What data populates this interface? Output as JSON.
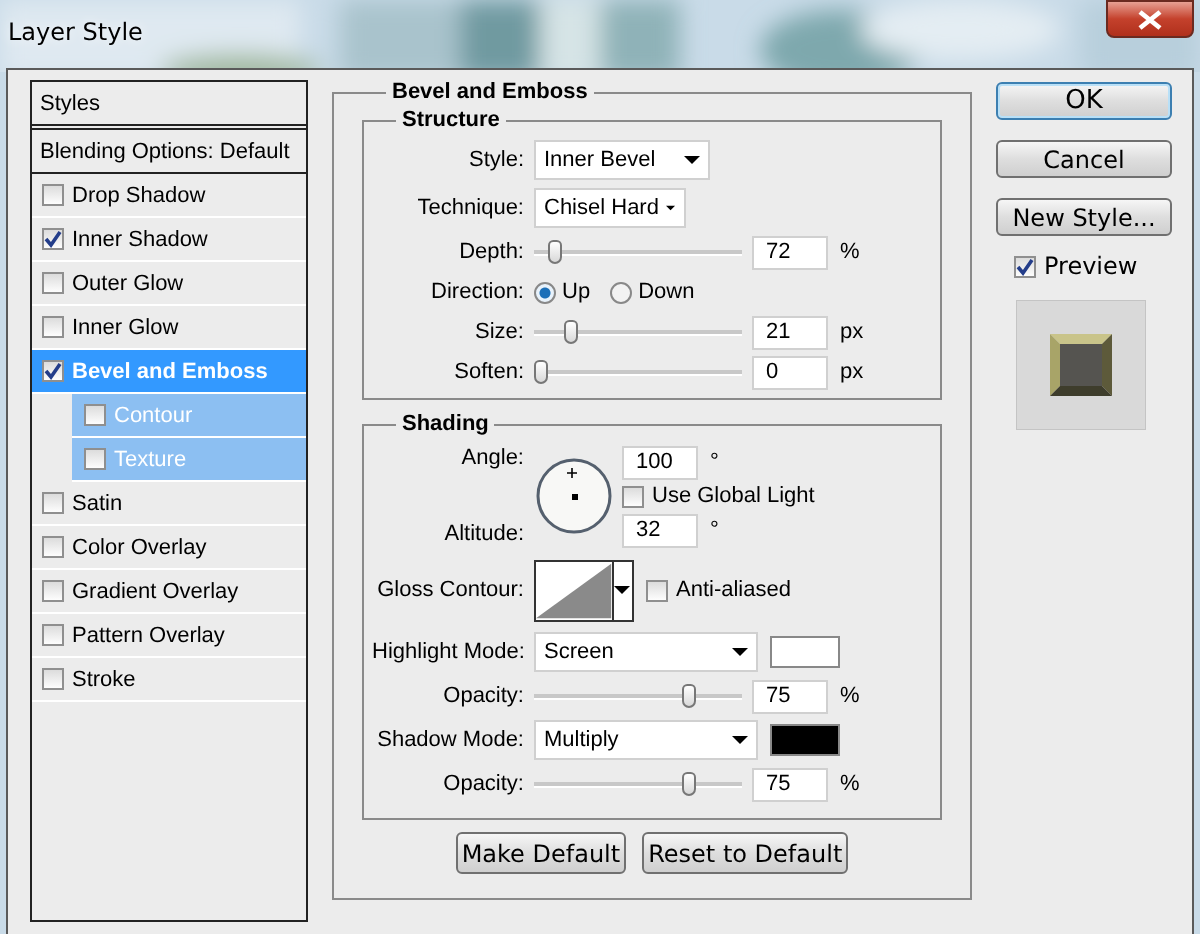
{
  "window": {
    "title": "Layer Style"
  },
  "style_list": [
    {
      "label": "Styles",
      "kind": "header",
      "selected": false
    },
    {
      "label": "Blending Options: Default",
      "kind": "header",
      "selected": false
    },
    {
      "label": "Drop Shadow",
      "kind": "effect",
      "checked": false,
      "selected": false
    },
    {
      "label": "Inner Shadow",
      "kind": "effect",
      "checked": true,
      "selected": false
    },
    {
      "label": "Outer Glow",
      "kind": "effect",
      "checked": false,
      "selected": false
    },
    {
      "label": "Inner Glow",
      "kind": "effect",
      "checked": false,
      "selected": false
    },
    {
      "label": "Bevel and Emboss",
      "kind": "effect",
      "checked": true,
      "selected": true,
      "children": [
        {
          "label": "Contour",
          "checked": false,
          "selected": false
        },
        {
          "label": "Texture",
          "checked": false,
          "selected": false
        }
      ]
    },
    {
      "label": "Satin",
      "kind": "effect",
      "checked": false,
      "selected": false
    },
    {
      "label": "Color Overlay",
      "kind": "effect",
      "checked": false,
      "selected": false
    },
    {
      "label": "Gradient Overlay",
      "kind": "effect",
      "checked": false,
      "selected": false
    },
    {
      "label": "Pattern Overlay",
      "kind": "effect",
      "checked": false,
      "selected": false
    },
    {
      "label": "Stroke",
      "kind": "effect",
      "checked": false,
      "selected": false
    }
  ],
  "panel": {
    "title": "Bevel and Emboss",
    "structure": {
      "title": "Structure",
      "style": {
        "label": "Style:",
        "value": "Inner Bevel"
      },
      "technique": {
        "label": "Technique:",
        "value": "Chisel Hard"
      },
      "depth": {
        "label": "Depth:",
        "level": 0.07,
        "value": "72",
        "unit": "%"
      },
      "direction": {
        "label": "Direction:",
        "options": [
          {
            "label": "Up",
            "selected": true
          },
          {
            "label": "Down",
            "selected": false
          }
        ]
      },
      "size": {
        "label": "Size:",
        "level": 0.15,
        "value": "21",
        "unit": "px"
      },
      "soften": {
        "label": "Soften:",
        "level": 0,
        "value": "0",
        "unit": "px"
      }
    },
    "shading": {
      "title": "Shading",
      "angle": {
        "label": "Angle:",
        "value": "100",
        "unit": "°"
      },
      "use_global_light": {
        "label": "Use Global Light",
        "checked": false
      },
      "altitude": {
        "label": "Altitude:",
        "value": "32",
        "unit": "°"
      },
      "gloss_contour": {
        "label": "Gloss Contour:"
      },
      "anti_aliased": {
        "label": "Anti-aliased",
        "checked": false
      },
      "highlight_mode": {
        "label": "Highlight Mode:",
        "value": "Screen",
        "color": "#ffffff"
      },
      "highlight_opacity": {
        "label": "Opacity:",
        "level": 0.75,
        "value": "75",
        "unit": "%"
      },
      "shadow_mode": {
        "label": "Shadow Mode:",
        "value": "Multiply",
        "color": "#000000"
      },
      "shadow_opacity": {
        "label": "Opacity:",
        "level": 0.75,
        "value": "75",
        "unit": "%"
      }
    },
    "buttons": [
      {
        "label": "Make Default"
      },
      {
        "label": "Reset to Default"
      }
    ]
  },
  "actions": [
    {
      "label": "OK",
      "default": true
    },
    {
      "label": "Cancel",
      "default": false
    },
    {
      "label": "New Style...",
      "default": false
    }
  ],
  "preview": {
    "label": "Preview",
    "checked": true
  }
}
